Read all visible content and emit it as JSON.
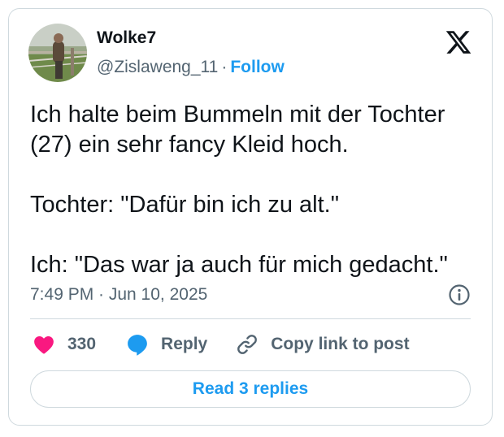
{
  "author": {
    "name": "Wolke7",
    "handle": "@Zislaweng_11",
    "separator": "·",
    "follow_label": "Follow"
  },
  "logo_icon": "x-logo-icon",
  "tweet": {
    "lines": [
      "Ich halte beim Bummeln mit der Tochter",
      "(27) ein sehr fancy Kleid hoch.",
      "Tochter: \"Dafür bin ich zu alt.\"",
      "Ich: \"Das war ja auch für mich gedacht.\""
    ]
  },
  "timestamp": "7:49 PM · Jun 10, 2025",
  "info_icon": "info-icon",
  "actions": {
    "like_count": "330",
    "reply_label": "Reply",
    "copy_label": "Copy link to post"
  },
  "colors": {
    "like": "#f91880",
    "accent": "#1d9bf0",
    "secondary_text": "#536471",
    "border": "#cfd9de"
  },
  "read_replies_label": "Read 3 replies"
}
